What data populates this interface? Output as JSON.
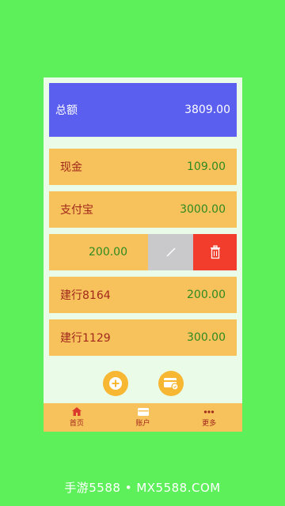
{
  "summary": {
    "label": "总额",
    "amount": "3809.00"
  },
  "accounts": [
    {
      "name": "现金",
      "amount": "109.00"
    },
    {
      "name": "支付宝",
      "amount": "3000.00"
    },
    {
      "name": "",
      "amount": "200.00"
    },
    {
      "name": "建行8164",
      "amount": "200.00"
    },
    {
      "name": "建行1129",
      "amount": "300.00"
    }
  ],
  "nav": [
    {
      "label": "首页",
      "icon": "home-icon"
    },
    {
      "label": "账户",
      "icon": "card-icon"
    },
    {
      "label": "更多",
      "icon": "more-icon"
    }
  ],
  "watermark": "手游5588 • MX5588.COM",
  "colors": {
    "background": "#5ef05a",
    "summary_card": "#5a5ff0",
    "row": "#f7c15c",
    "name_text": "#a2281c",
    "amount_text": "#2e8b1f",
    "edit_action": "#c9c9cc",
    "delete_action": "#f23c2c",
    "fab": "#f7b733"
  }
}
